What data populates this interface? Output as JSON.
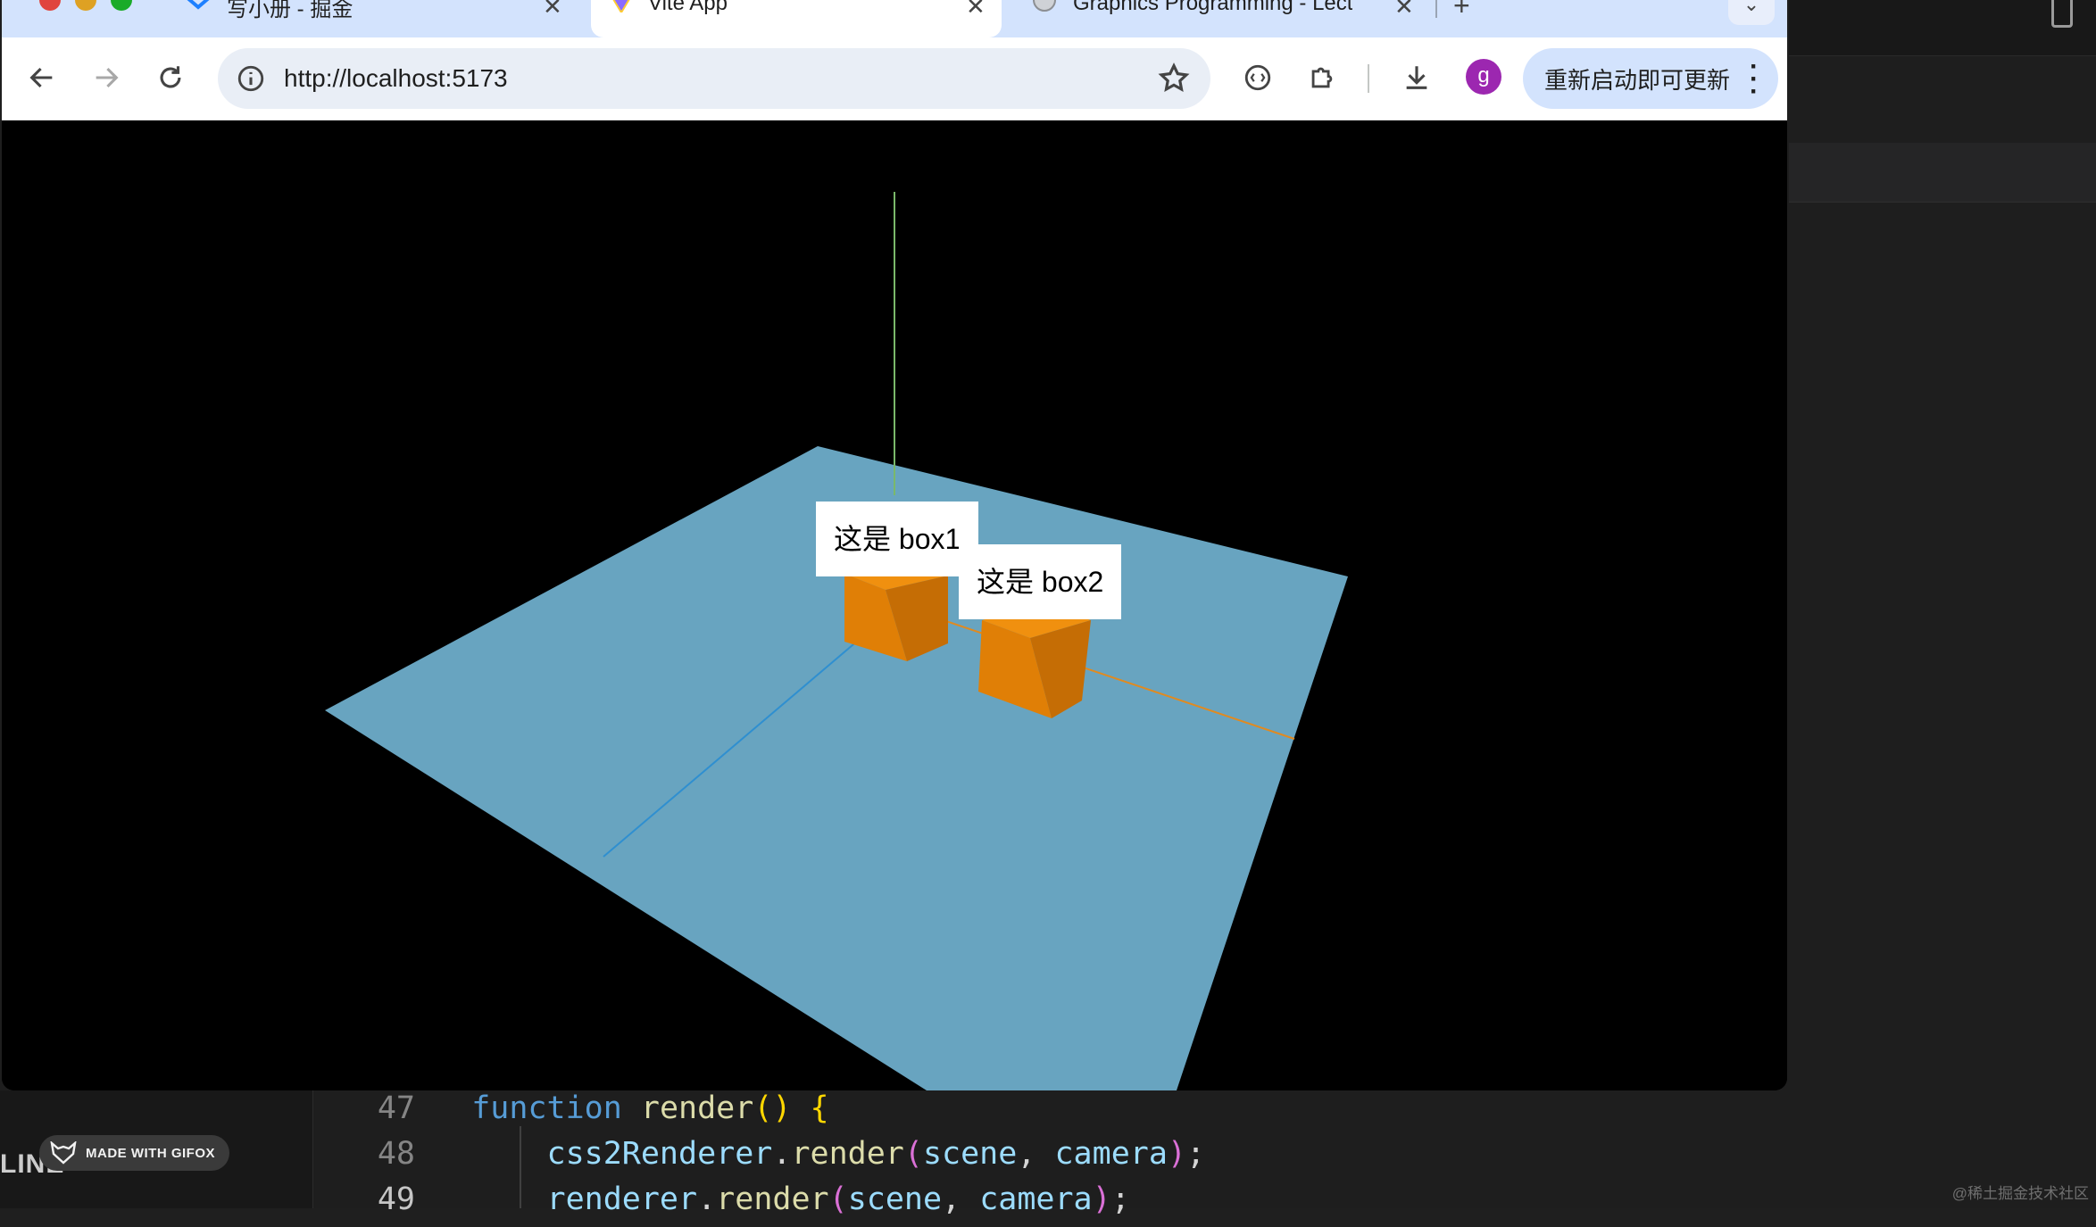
{
  "browser": {
    "tabs": [
      {
        "title": "写小册 - 掘金",
        "active": false
      },
      {
        "title": "Vite App",
        "active": true
      },
      {
        "title": "Graphics Programming - Lect",
        "active": false
      }
    ],
    "address_bar": {
      "url": "http://localhost:5173"
    },
    "profile_initial": "g",
    "update_button_label": "重新启动即可更新",
    "colors": {
      "tabstrip": "#d3e3fd",
      "toolbar": "#ffffff",
      "avatar": "#9c27b0"
    }
  },
  "scene": {
    "background": "#000000",
    "plane_color": "#68a4c0",
    "box_color": "#e07f06",
    "axes_colors": {
      "x": "#e08a20",
      "y": "#7ab86a",
      "z": "#2f8fd0"
    },
    "labels": [
      "这是 box1",
      "这是 box2"
    ]
  },
  "editor": {
    "outline_label": "LINE",
    "code_lines": [
      {
        "number": "47",
        "tokens": [
          {
            "t": "function",
            "c": "kw"
          },
          {
            "t": " ",
            "c": "punc"
          },
          {
            "t": "render",
            "c": "fn"
          },
          {
            "t": "()",
            "c": "br1"
          },
          {
            "t": " ",
            "c": "punc"
          },
          {
            "t": "{",
            "c": "br1"
          }
        ]
      },
      {
        "number": "48",
        "tokens": [
          {
            "t": "    css2Renderer",
            "c": "var"
          },
          {
            "t": ".",
            "c": "punc"
          },
          {
            "t": "render",
            "c": "fn"
          },
          {
            "t": "(",
            "c": "br2"
          },
          {
            "t": "scene",
            "c": "var"
          },
          {
            "t": ", ",
            "c": "punc"
          },
          {
            "t": "camera",
            "c": "var"
          },
          {
            "t": ")",
            "c": "br2"
          },
          {
            "t": ";",
            "c": "punc"
          }
        ]
      },
      {
        "number": "49",
        "tokens": [
          {
            "t": "    renderer",
            "c": "var"
          },
          {
            "t": ".",
            "c": "punc"
          },
          {
            "t": "render",
            "c": "fn"
          },
          {
            "t": "(",
            "c": "br2"
          },
          {
            "t": "scene",
            "c": "var"
          },
          {
            "t": ", ",
            "c": "punc"
          },
          {
            "t": "camera",
            "c": "var"
          },
          {
            "t": ")",
            "c": "br2"
          },
          {
            "t": ";",
            "c": "punc"
          }
        ]
      }
    ]
  },
  "overlay": {
    "gifox_badge": "MADE WITH GIFOX",
    "watermark": "@稀土掘金技术社区"
  }
}
